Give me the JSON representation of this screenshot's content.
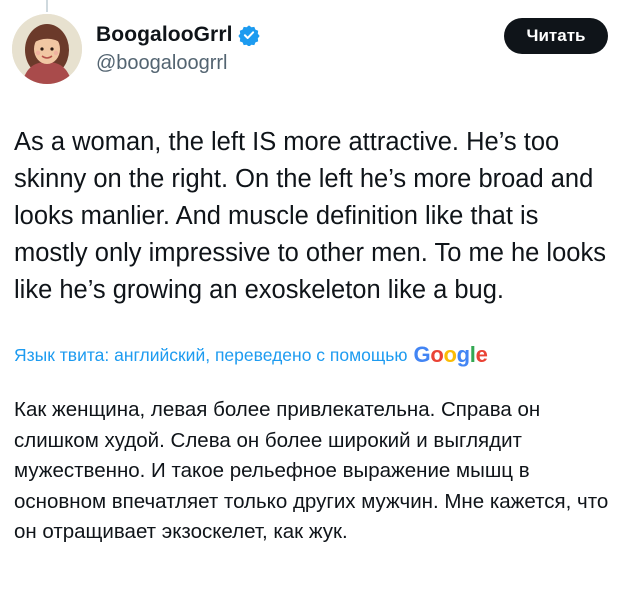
{
  "author": {
    "display_name": "BoogalooGrrl",
    "handle": "@boogaloogrrl",
    "verified_icon": "verified-badge-icon",
    "avatar_icon": "avatar-image"
  },
  "follow_button": {
    "label": "Читать"
  },
  "tweet": {
    "text": "As a woman, the left IS more attractive. He’s too skinny on the right. On the left he’s more broad and looks manlier. And muscle definition like that is mostly only impressive to other men. To me he looks like he’s growing an exoskeleton like a bug."
  },
  "translation": {
    "label": "Язык твита: английский, переведено с помощью",
    "provider_letters": [
      "G",
      "o",
      "o",
      "g",
      "l",
      "e"
    ],
    "text": "Как женщина, левая более привлекательна. Справа он слишком худой. Слева он более широкий и выглядит мужественно. И такое рельефное выражение мышц в основном впечатляет только других мужчин. Мне кажется, что он отращивает экзоскелет, как жук."
  },
  "colors": {
    "accent": "#1d9bf0",
    "text_primary": "#0f1419",
    "text_secondary": "#536471",
    "button_bg": "#0f1419"
  }
}
